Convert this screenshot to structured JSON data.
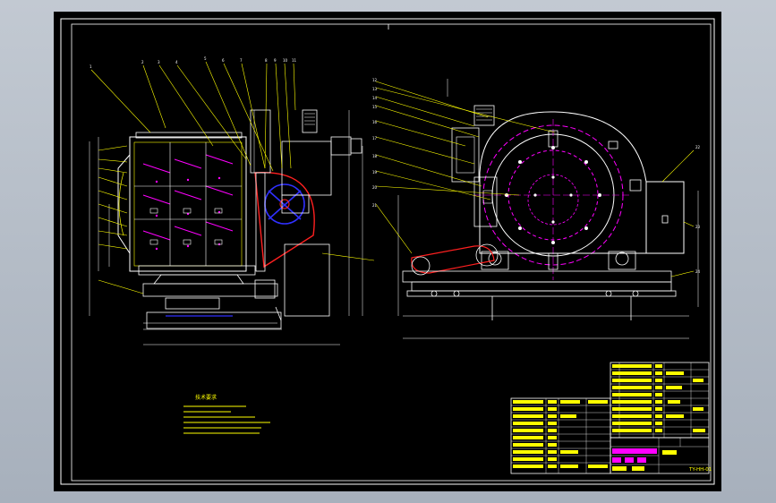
{
  "colors": {
    "background": "#000000",
    "frame": "#ffffff",
    "border_inner": "#ffff00",
    "machine_outline": "#ffffff",
    "leaders": "#ffff00",
    "magenta": "#ff00ff",
    "red": "#ff2020",
    "blue": "#3030ff",
    "table_fill": "#ffff00",
    "table_magenta": "#ff00ff"
  },
  "title_block": {
    "drawing_number": "TY-HH-01"
  },
  "notes": {
    "header": "技术要求"
  }
}
